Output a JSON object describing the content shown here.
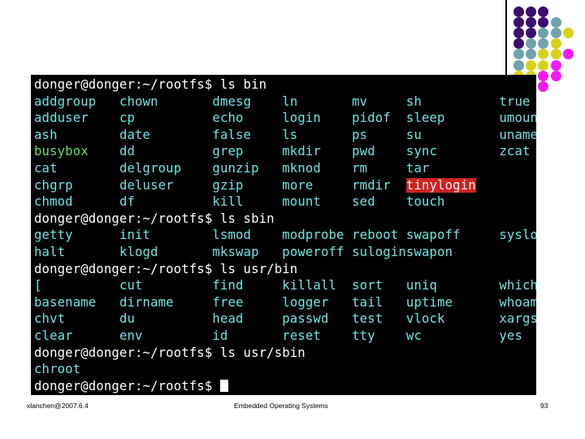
{
  "slide": {
    "page_number": "93",
    "footer_left": "xlanchen@2007.6.4",
    "footer_center": "Embedded Operating Systems"
  },
  "decoration": {
    "name": "dot-grid",
    "colors": {
      "purple": "#3a0f6e",
      "teal": "#6fa3ac",
      "yellow": "#d8d119",
      "magenta": "#f319f3"
    },
    "rows": [
      [
        "purple",
        "purple",
        "purple"
      ],
      [
        "purple",
        "purple",
        "purple",
        "teal"
      ],
      [
        "purple",
        "purple",
        "teal",
        "teal",
        "yellow"
      ],
      [
        "purple",
        "teal",
        "teal",
        "yellow"
      ],
      [
        "teal",
        "teal",
        "yellow",
        "yellow",
        "magenta"
      ],
      [
        "teal",
        "yellow",
        "yellow",
        "magenta"
      ],
      [
        "yellow",
        "yellow",
        "magenta",
        "magenta"
      ],
      [
        "magenta",
        "magenta",
        "magenta"
      ],
      [
        "magenta",
        "magenta"
      ]
    ]
  },
  "terminal": {
    "colors": {
      "background": "#000000",
      "prompt": "#ffffff",
      "symlink": "#6fe3e1",
      "executable": "#5fe35f",
      "orphan_background": "#cc2222"
    },
    "prompt_text": "donger@donger:~/rootfs$ ",
    "lines": [
      {
        "type": "command",
        "prompt": "donger@donger:~/rootfs$ ",
        "command": "ls bin"
      },
      {
        "type": "listing",
        "cells": [
          {
            "text": "addgroup",
            "color": "link"
          },
          {
            "text": "chown",
            "color": "link"
          },
          {
            "text": "dmesg",
            "color": "link"
          },
          {
            "text": "ln",
            "color": "link"
          },
          {
            "text": "mv",
            "color": "link"
          },
          {
            "text": "sh",
            "color": "link"
          },
          {
            "text": "true",
            "color": "link"
          }
        ]
      },
      {
        "type": "listing",
        "cells": [
          {
            "text": "adduser",
            "color": "link"
          },
          {
            "text": "cp",
            "color": "link"
          },
          {
            "text": "echo",
            "color": "link"
          },
          {
            "text": "login",
            "color": "link"
          },
          {
            "text": "pidof",
            "color": "link"
          },
          {
            "text": "sleep",
            "color": "link"
          },
          {
            "text": "umount",
            "color": "link"
          }
        ]
      },
      {
        "type": "listing",
        "cells": [
          {
            "text": "ash",
            "color": "link"
          },
          {
            "text": "date",
            "color": "link"
          },
          {
            "text": "false",
            "color": "link"
          },
          {
            "text": "ls",
            "color": "link"
          },
          {
            "text": "ps",
            "color": "link"
          },
          {
            "text": "su",
            "color": "link"
          },
          {
            "text": "uname",
            "color": "link"
          }
        ]
      },
      {
        "type": "listing",
        "cells": [
          {
            "text": "busybox",
            "color": "exec"
          },
          {
            "text": "dd",
            "color": "link"
          },
          {
            "text": "grep",
            "color": "link"
          },
          {
            "text": "mkdir",
            "color": "link"
          },
          {
            "text": "pwd",
            "color": "link"
          },
          {
            "text": "sync",
            "color": "link"
          },
          {
            "text": "zcat",
            "color": "link"
          }
        ]
      },
      {
        "type": "listing",
        "cells": [
          {
            "text": "cat",
            "color": "link"
          },
          {
            "text": "delgroup",
            "color": "link"
          },
          {
            "text": "gunzip",
            "color": "link"
          },
          {
            "text": "mknod",
            "color": "link"
          },
          {
            "text": "rm",
            "color": "link"
          },
          {
            "text": "tar",
            "color": "link"
          }
        ]
      },
      {
        "type": "listing",
        "cells": [
          {
            "text": "chgrp",
            "color": "link"
          },
          {
            "text": "deluser",
            "color": "link"
          },
          {
            "text": "gzip",
            "color": "link"
          },
          {
            "text": "more",
            "color": "link"
          },
          {
            "text": "rmdir",
            "color": "link"
          },
          {
            "text": "tinylogin",
            "color": "orphan"
          }
        ]
      },
      {
        "type": "listing",
        "cells": [
          {
            "text": "chmod",
            "color": "link"
          },
          {
            "text": "df",
            "color": "link"
          },
          {
            "text": "kill",
            "color": "link"
          },
          {
            "text": "mount",
            "color": "link"
          },
          {
            "text": "sed",
            "color": "link"
          },
          {
            "text": "touch",
            "color": "link"
          }
        ]
      },
      {
        "type": "command",
        "prompt": "donger@donger:~/rootfs$ ",
        "command": "ls sbin"
      },
      {
        "type": "listing",
        "cells": [
          {
            "text": "getty",
            "color": "link"
          },
          {
            "text": "init",
            "color": "link"
          },
          {
            "text": "lsmod",
            "color": "link"
          },
          {
            "text": "modprobe",
            "color": "link"
          },
          {
            "text": "reboot",
            "color": "link"
          },
          {
            "text": "swapoff",
            "color": "link"
          },
          {
            "text": "syslogd",
            "color": "link"
          }
        ]
      },
      {
        "type": "listing",
        "cells": [
          {
            "text": "halt",
            "color": "link"
          },
          {
            "text": "klogd",
            "color": "link"
          },
          {
            "text": "mkswap",
            "color": "link"
          },
          {
            "text": "poweroff",
            "color": "link"
          },
          {
            "text": "sulogin",
            "color": "link"
          },
          {
            "text": "swapon",
            "color": "link"
          }
        ]
      },
      {
        "type": "command",
        "prompt": "donger@donger:~/rootfs$ ",
        "command": "ls usr/bin"
      },
      {
        "type": "listing",
        "cells": [
          {
            "text": "[",
            "color": "link"
          },
          {
            "text": "cut",
            "color": "link"
          },
          {
            "text": "find",
            "color": "link"
          },
          {
            "text": "killall",
            "color": "link"
          },
          {
            "text": "sort",
            "color": "link"
          },
          {
            "text": "uniq",
            "color": "link"
          },
          {
            "text": "which",
            "color": "link"
          }
        ]
      },
      {
        "type": "listing",
        "cells": [
          {
            "text": "basename",
            "color": "link"
          },
          {
            "text": "dirname",
            "color": "link"
          },
          {
            "text": "free",
            "color": "link"
          },
          {
            "text": "logger",
            "color": "link"
          },
          {
            "text": "tail",
            "color": "link"
          },
          {
            "text": "uptime",
            "color": "link"
          },
          {
            "text": "whoami",
            "color": "link"
          }
        ]
      },
      {
        "type": "listing",
        "cells": [
          {
            "text": "chvt",
            "color": "link"
          },
          {
            "text": "du",
            "color": "link"
          },
          {
            "text": "head",
            "color": "link"
          },
          {
            "text": "passwd",
            "color": "link"
          },
          {
            "text": "test",
            "color": "link"
          },
          {
            "text": "vlock",
            "color": "link"
          },
          {
            "text": "xargs",
            "color": "link"
          }
        ]
      },
      {
        "type": "listing",
        "cells": [
          {
            "text": "clear",
            "color": "link"
          },
          {
            "text": "env",
            "color": "link"
          },
          {
            "text": "id",
            "color": "link"
          },
          {
            "text": "reset",
            "color": "link"
          },
          {
            "text": "tty",
            "color": "link"
          },
          {
            "text": "wc",
            "color": "link"
          },
          {
            "text": "yes",
            "color": "link"
          }
        ]
      },
      {
        "type": "command",
        "prompt": "donger@donger:~/rootfs$ ",
        "command": "ls usr/sbin"
      },
      {
        "type": "listing",
        "cells": [
          {
            "text": "chroot",
            "color": "link"
          }
        ]
      },
      {
        "type": "command",
        "prompt": "donger@donger:~/rootfs$ ",
        "command": "",
        "cursor": true
      }
    ],
    "column_starts": [
      0,
      11,
      23,
      32,
      41,
      48,
      60
    ]
  }
}
